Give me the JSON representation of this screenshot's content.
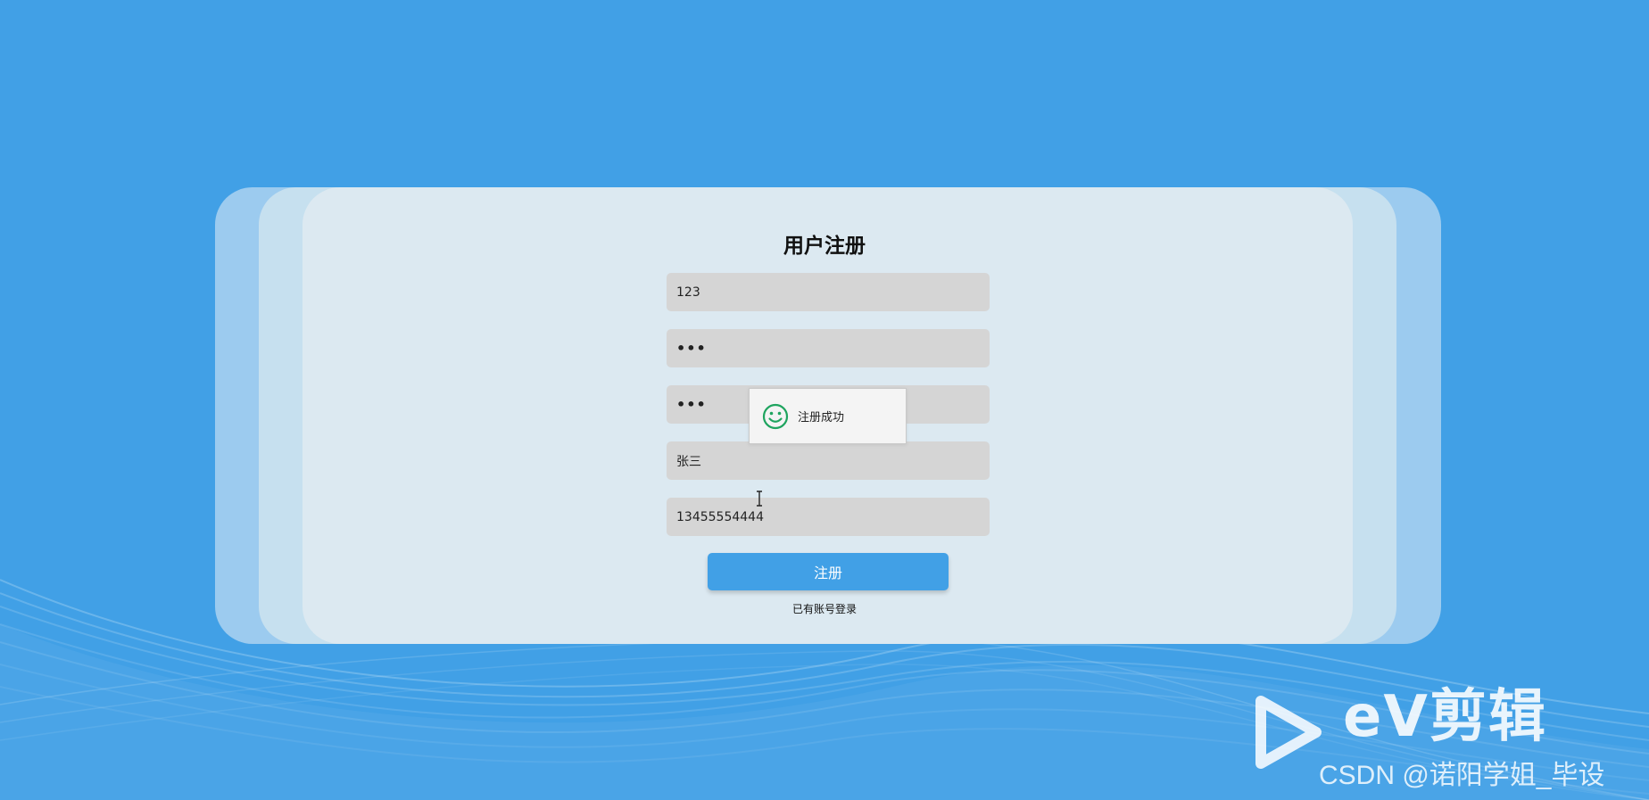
{
  "form": {
    "title": "用户注册",
    "username_value": "123",
    "password_value": "•••",
    "confirm_password_value": "•••",
    "name_value": "张三",
    "phone_value": "13455554444",
    "submit_label": "注册",
    "login_link": "已有账号登录"
  },
  "toast": {
    "icon": "smile-icon",
    "message": "注册成功",
    "color": "#1fa45f"
  },
  "watermark": {
    "brand": "eV剪辑",
    "credit": "CSDN @诺阳学姐_毕设"
  },
  "colors": {
    "background": "#41a0e6",
    "card": "#dce9f1",
    "field": "#d5d5d5",
    "button": "#41a0e6"
  }
}
